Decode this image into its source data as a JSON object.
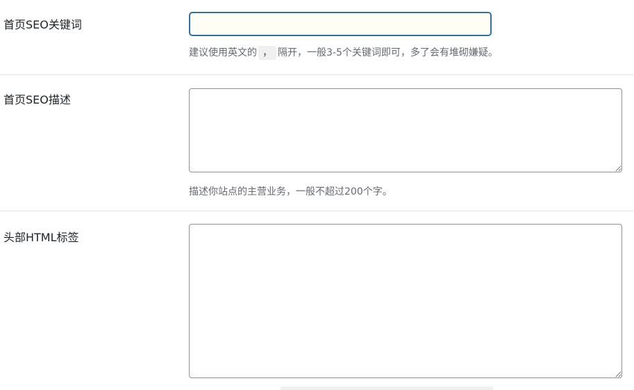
{
  "fields": {
    "home_keywords": {
      "label": "首页SEO关键词",
      "value": "",
      "placeholder": "",
      "hint_before": "建议使用英文的",
      "hint_separator": "，",
      "hint_after": "隔开，一般3-5个关键词即可，多了会有堆砌嫌疑。"
    },
    "home_description": {
      "label": "首页SEO描述",
      "value": "",
      "placeholder": "",
      "hint": "描述你站点的主营业务，一般不超过200个字。"
    },
    "head_html": {
      "label": "头部HTML标签",
      "value": "",
      "placeholder": ""
    }
  },
  "colors": {
    "focus_border": "#2f6ea6",
    "focus_background": "#fffef5",
    "hint_text": "#646970",
    "divider": "#e5e5e5"
  }
}
